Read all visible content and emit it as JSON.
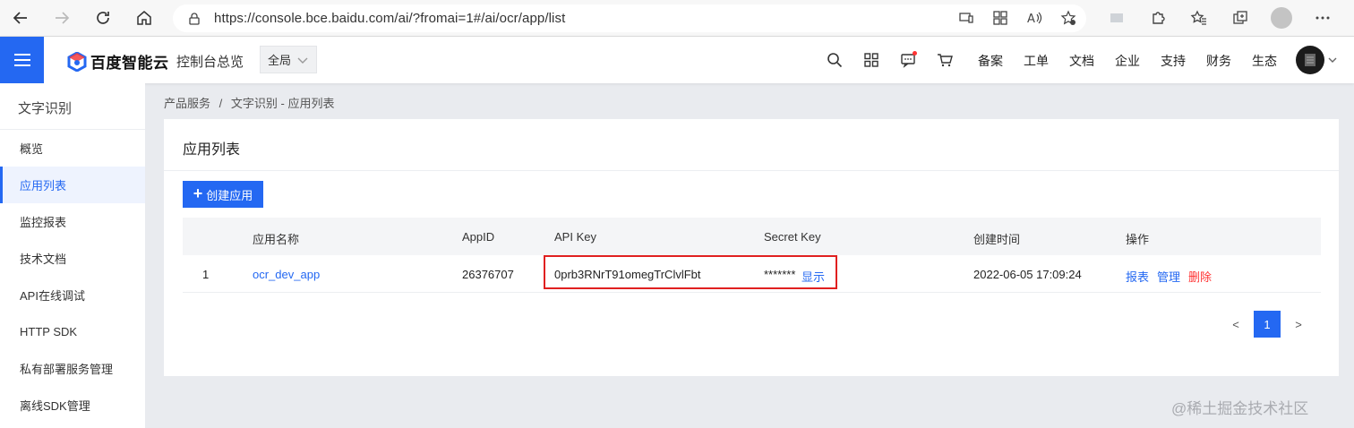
{
  "browser": {
    "url": "https://console.bce.baidu.com/ai/?fromai=1#/ai/ocr/app/list"
  },
  "header": {
    "logo_text": "百度智能云",
    "console_title": "控制台总览",
    "region": "全局",
    "links": [
      "备案",
      "工单",
      "文档",
      "企业",
      "支持",
      "财务",
      "生态"
    ]
  },
  "sidebar": {
    "title": "文字识别",
    "items": [
      {
        "label": "概览",
        "active": false
      },
      {
        "label": "应用列表",
        "active": true
      },
      {
        "label": "监控报表",
        "active": false
      },
      {
        "label": "技术文档",
        "active": false
      },
      {
        "label": "API在线调试",
        "active": false
      },
      {
        "label": "HTTP SDK",
        "active": false
      },
      {
        "label": "私有部署服务管理",
        "active": false
      },
      {
        "label": "离线SDK管理",
        "active": false
      }
    ]
  },
  "breadcrumb": {
    "parent": "产品服务",
    "separator": "/",
    "current": "文字识别 - 应用列表"
  },
  "card": {
    "title": "应用列表",
    "create_label": "创建应用"
  },
  "table": {
    "headers": {
      "name": "应用名称",
      "appid": "AppID",
      "apikey": "API Key",
      "secret": "Secret Key",
      "created": "创建时间",
      "ops": "操作"
    },
    "rows": [
      {
        "index": "1",
        "name": "ocr_dev_app",
        "appid": "26376707",
        "apikey": "0prb3RNrT91omegTrClvlFbt",
        "secret_masked": "*******",
        "show_label": "显示",
        "created": "2022-06-05 17:09:24",
        "op_report": "报表",
        "op_manage": "管理",
        "op_delete": "删除"
      }
    ]
  },
  "pagination": {
    "prev": "<",
    "current": "1",
    "next": ">"
  },
  "watermark": "@稀土掘金技术社区",
  "colors": {
    "primary": "#2468f2",
    "danger": "#f33333",
    "highlight": "#e02020"
  }
}
